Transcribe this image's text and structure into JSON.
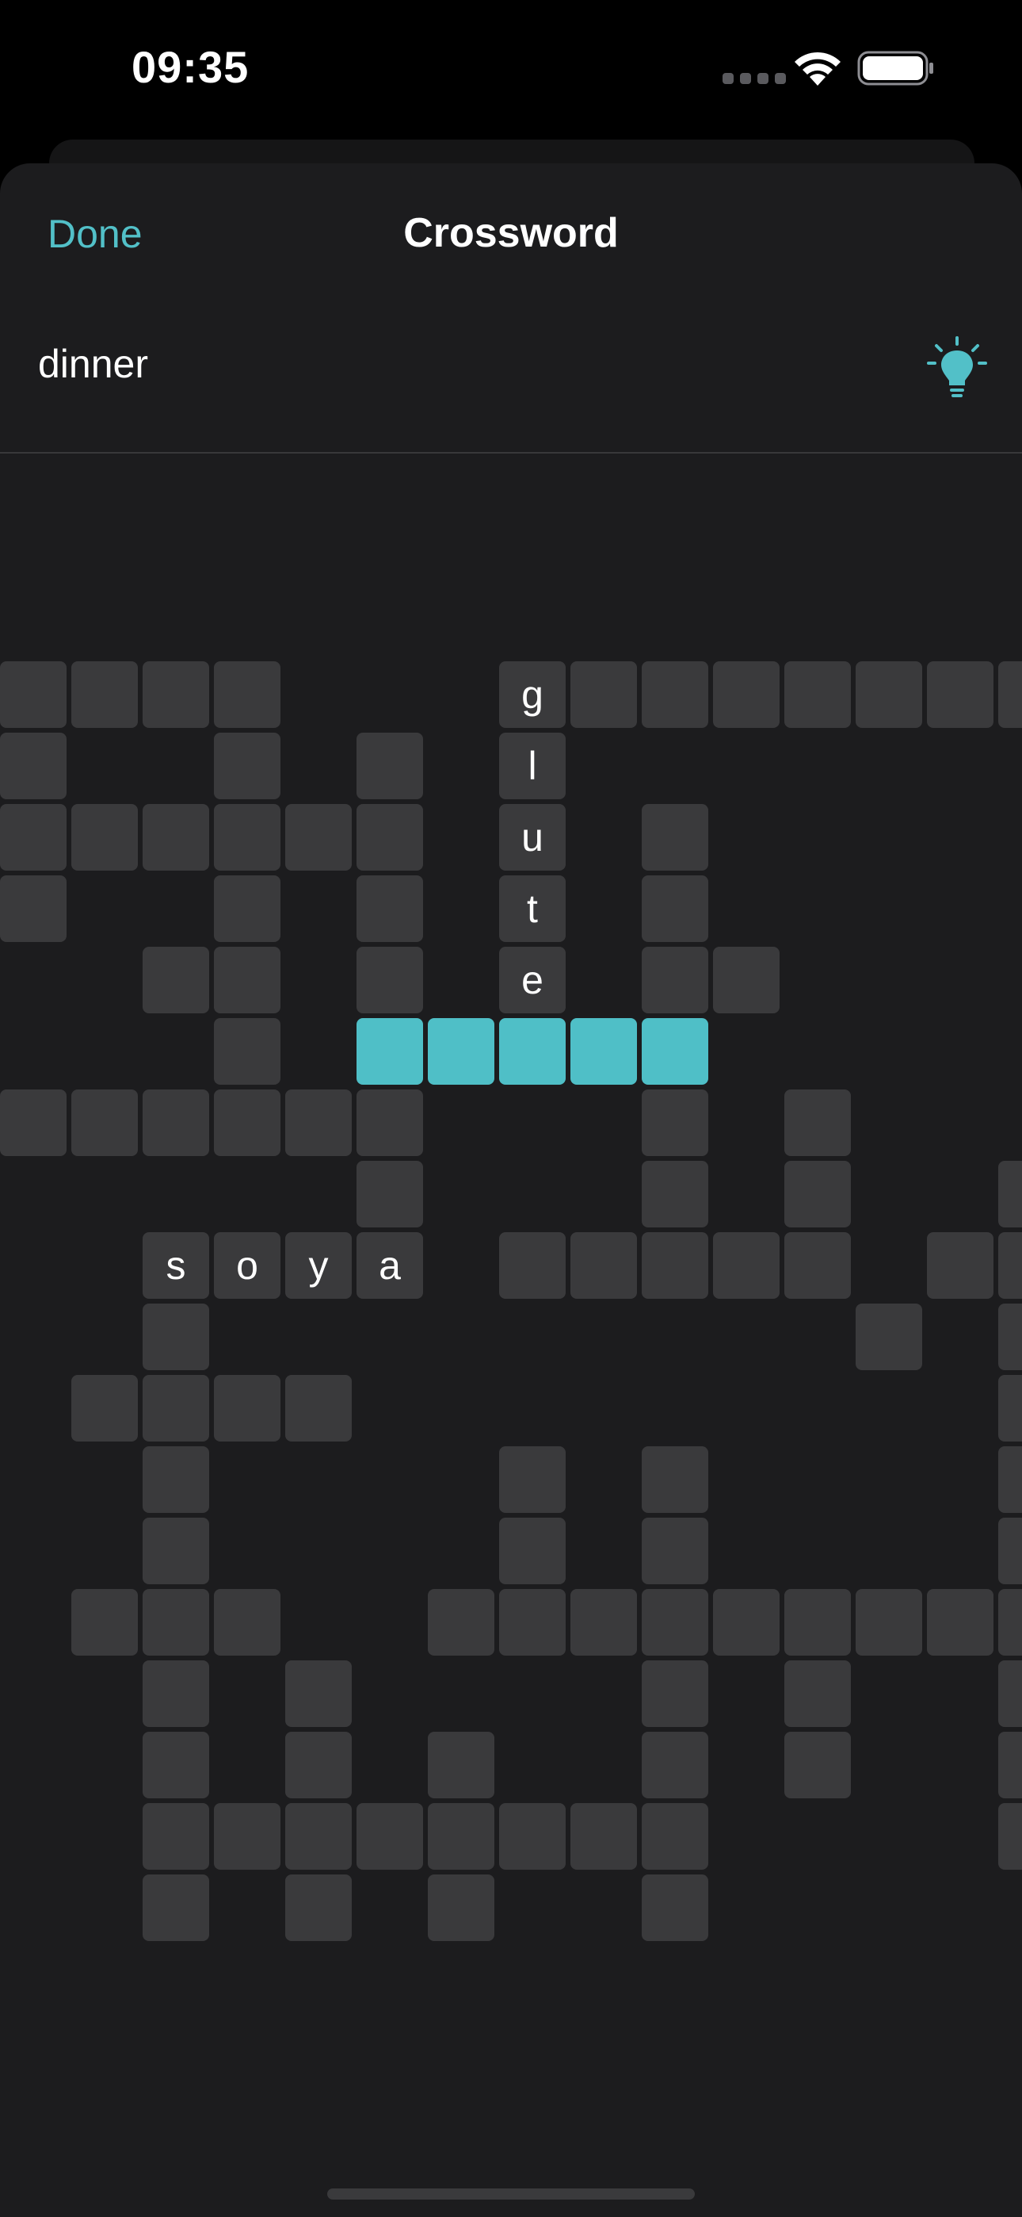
{
  "status_bar": {
    "time": "09:35"
  },
  "header": {
    "done_label": "Done",
    "title": "Crossword"
  },
  "clue": {
    "text": "dinner"
  },
  "colors": {
    "accent": "#52c0c8",
    "active_cell": "#4fbfc7",
    "cell": "#3a3a3c",
    "sheet": "#1c1c1e"
  },
  "icons": {
    "hint": "lightbulb-icon"
  },
  "puzzle": {
    "rows": [
      "####...g#######",
      "#..#.#.l.......",
      "######.u.#.....",
      "#..#.#.t.#.....",
      "..##.#.e.##....",
      "...#.#####.....",
      "######...#.#...",
      ".....#...#.#..#",
      "..soya.#####.##",
      "..#.........#.#",
      ".####.........#",
      "..#....#.#....#",
      "..#....#.#....#",
      ".###..#########",
      "..#.#....#.#..#",
      "..#.#.#..#.#..#",
      "..########....#",
      "..#.#.#..#....."
    ],
    "active": [
      [
        5,
        5
      ],
      [
        5,
        6
      ],
      [
        5,
        7
      ],
      [
        5,
        8
      ],
      [
        5,
        9
      ]
    ]
  }
}
